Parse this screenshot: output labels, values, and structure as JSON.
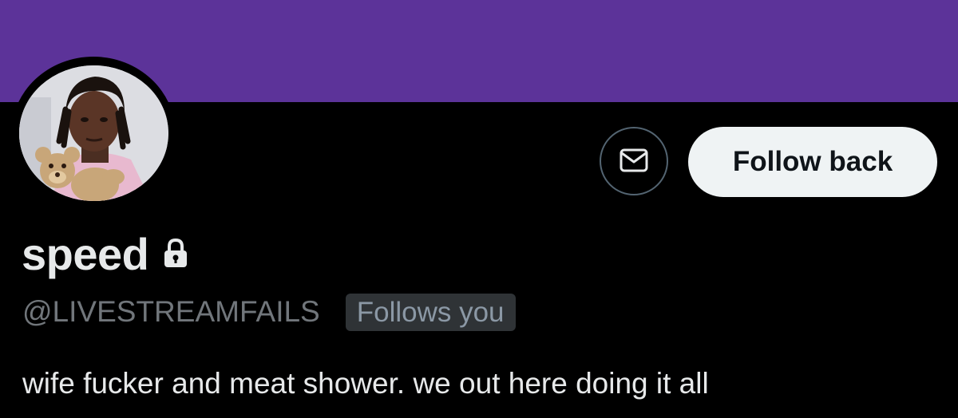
{
  "profile": {
    "display_name": "speed",
    "handle": "@LIVESTREAMFAILS",
    "follows_you_label": "Follows you",
    "bio": "wife fucker and meat shower. we out here doing it all"
  },
  "actions": {
    "follow_back_label": "Follow back",
    "message_icon": "envelope-icon"
  },
  "icons": {
    "protected": "lock-icon",
    "message": "envelope-icon"
  },
  "colors": {
    "banner": "#5c3399",
    "background": "#000000",
    "follow_button_bg": "#eff3f4",
    "follow_button_text": "#0f1419",
    "handle_text": "#71767b",
    "badge_bg": "#2f3336"
  }
}
